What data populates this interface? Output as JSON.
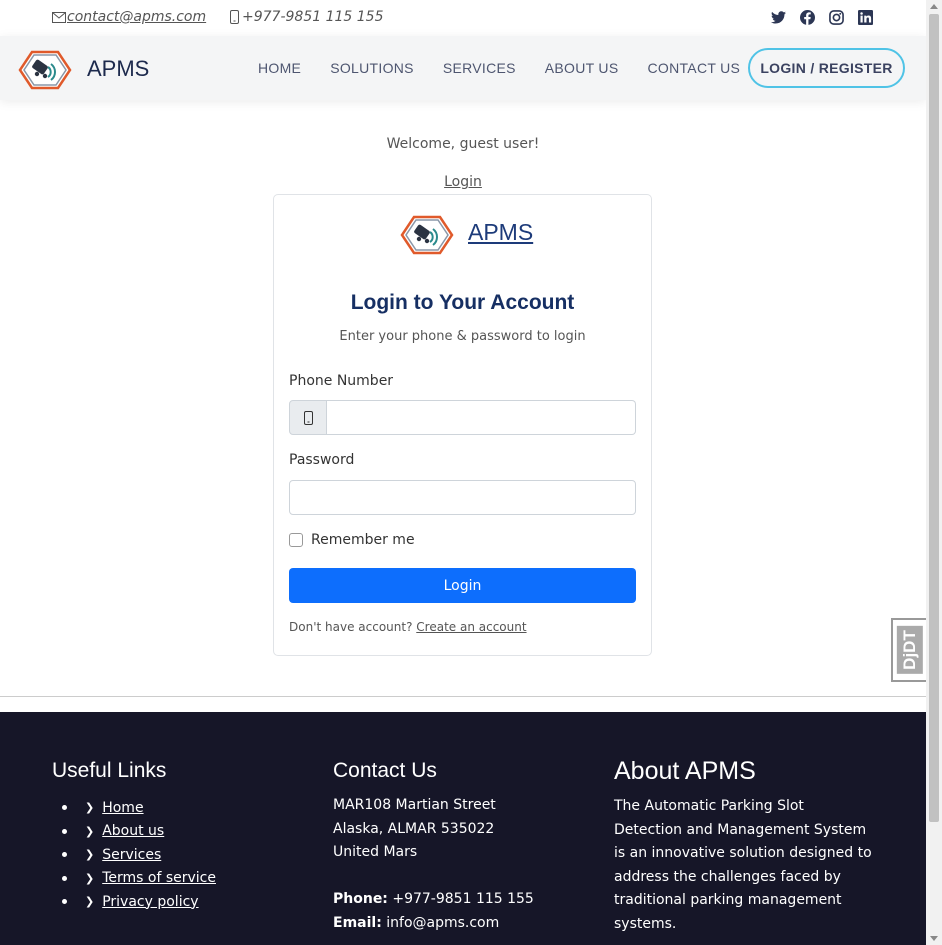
{
  "topbar": {
    "email": "contact@apms.com",
    "phone": "+977-9851 115 155",
    "social_icons": [
      "twitter-icon",
      "facebook-icon",
      "instagram-icon",
      "linkedin-icon"
    ]
  },
  "header": {
    "brand": "APMS",
    "nav": [
      "HOME",
      "SOLUTIONS",
      "SERVICES",
      "ABOUT US",
      "CONTACT US"
    ],
    "login_register": "LOGIN / REGISTER"
  },
  "main": {
    "welcome": "Welcome, guest user!",
    "login_link": "Login"
  },
  "card": {
    "brand": "APMS",
    "title": "Login to Your Account",
    "subtitle": "Enter your phone & password to login",
    "phone_label": "Phone Number",
    "phone_value": "",
    "password_label": "Password",
    "password_value": "",
    "remember_label": "Remember me",
    "remember_checked": false,
    "login_button": "Login",
    "no_account_text": "Don't have account?",
    "create_account_link": "Create an account"
  },
  "footer": {
    "useful_links": {
      "heading": "Useful Links",
      "items": [
        "Home",
        "About us",
        "Services",
        "Terms of service",
        "Privacy policy"
      ]
    },
    "contact": {
      "heading": "Contact Us",
      "address_line1": "MAR108 Martian Street",
      "address_line2": "Alaska, ALMAR 535022",
      "address_line3": "United Mars",
      "phone_label": "Phone:",
      "phone": "+977-9851 115 155",
      "email_label": "Email:",
      "email": "info@apms.com"
    },
    "about": {
      "heading": "About APMS",
      "text": "The Automatic Parking Slot Detection and Management System is an innovative solution designed to address the challenges faced by traditional parking management systems."
    }
  },
  "debug_toolbar": {
    "label": "DjDT"
  },
  "colors": {
    "primary_button": "#0d6efd",
    "footer_bg": "#161628",
    "accent_border": "#4fc3e6",
    "title": "#162f63"
  }
}
